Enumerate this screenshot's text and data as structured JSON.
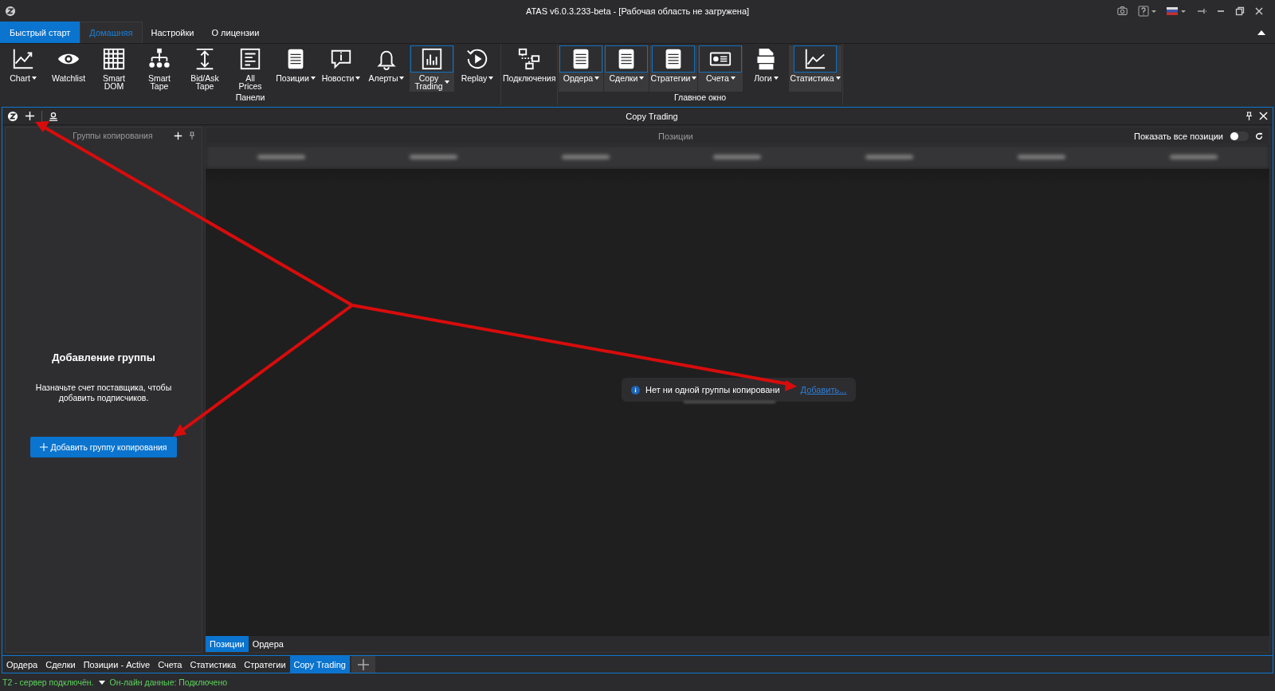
{
  "window": {
    "title": "ATAS v6.0.3.233-beta - [Рабочая область не загружена]"
  },
  "ribbon_tabs": [
    {
      "label": "Быстрый старт",
      "kind": "quick",
      "selected": false
    },
    {
      "label": "Домашняя",
      "kind": "tab",
      "selected": true
    },
    {
      "label": "Настройки",
      "kind": "tab",
      "selected": false
    },
    {
      "label": "О лицензии",
      "kind": "tab",
      "selected": false
    }
  ],
  "ribbon_groups": [
    {
      "label": "Панели",
      "buttons": [
        {
          "lines": [
            "Chart"
          ],
          "dropdown": true,
          "selected": false
        },
        {
          "lines": [
            "Watchlist"
          ],
          "dropdown": false,
          "selected": false
        },
        {
          "lines": [
            "Smart",
            "DOM"
          ],
          "dropdown": false,
          "selected": false
        },
        {
          "lines": [
            "Smart",
            "Tape"
          ],
          "dropdown": false,
          "selected": false
        },
        {
          "lines": [
            "Bid/Ask",
            "Tape"
          ],
          "dropdown": false,
          "selected": false
        },
        {
          "lines": [
            "All",
            "Prices"
          ],
          "dropdown": false,
          "selected": false
        },
        {
          "lines": [
            "Позиции"
          ],
          "dropdown": true,
          "selected": false
        },
        {
          "lines": [
            "Новости"
          ],
          "dropdown": true,
          "selected": false
        },
        {
          "lines": [
            "Алерты"
          ],
          "dropdown": true,
          "selected": false
        },
        {
          "lines": [
            "Copy",
            "Trading"
          ],
          "dropdown": true,
          "selected": true
        },
        {
          "lines": [
            "Replay"
          ],
          "dropdown": true,
          "selected": false
        }
      ]
    },
    {
      "buttons": [
        {
          "lines": [
            "Подключения"
          ],
          "dropdown": false,
          "selected": false
        }
      ]
    },
    {
      "label": "Главное окно",
      "buttons": [
        {
          "lines": [
            "Ордера"
          ],
          "dropdown": true,
          "selected": true
        },
        {
          "lines": [
            "Сделки"
          ],
          "dropdown": true,
          "selected": true
        },
        {
          "lines": [
            "Стратегии"
          ],
          "dropdown": true,
          "selected": true
        },
        {
          "lines": [
            "Счета"
          ],
          "dropdown": true,
          "selected": true
        },
        {
          "lines": [
            "Логи"
          ],
          "dropdown": true,
          "selected": false
        },
        {
          "lines": [
            "Статистика"
          ],
          "dropdown": true,
          "selected": true
        }
      ]
    }
  ],
  "document": {
    "title": "Copy Trading"
  },
  "groups_panel": {
    "title": "Группы копирования",
    "empty_title": "Добавление группы",
    "empty_text": "Назначьте счет поставщика, чтобы добавить подписчиков.",
    "add_button": "Добавить группу копирования"
  },
  "positions_panel": {
    "title": "Позиции",
    "show_all": {
      "label": "Показать все позиции",
      "on": false
    },
    "notice": {
      "text": "Нет ни одной группы копировани",
      "link": "Добавить..."
    },
    "tabs": [
      {
        "label": "Позиции",
        "selected": true
      },
      {
        "label": "Ордера",
        "selected": false
      }
    ]
  },
  "workspace_tabs": [
    {
      "label": "Ордера",
      "selected": false
    },
    {
      "label": "Сделки",
      "selected": false
    },
    {
      "label": "Позиции - Active",
      "selected": false
    },
    {
      "label": "Счета",
      "selected": false
    },
    {
      "label": "Статистика",
      "selected": false
    },
    {
      "label": "Стратегии",
      "selected": false
    },
    {
      "label": "Copy Trading",
      "selected": true
    }
  ],
  "status_bar": {
    "server": "Т2 - сервер подключён.",
    "data": "Он-лайн данные: Подключено"
  }
}
